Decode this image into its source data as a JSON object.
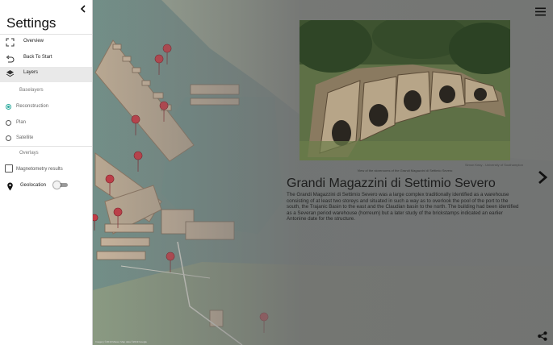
{
  "sidebar": {
    "title": "Settings",
    "items": [
      {
        "label": "Overview",
        "icon": "fullscreen-icon"
      },
      {
        "label": "Back To Start",
        "icon": "undo-icon"
      },
      {
        "label": "Layers",
        "icon": "layers-icon"
      }
    ],
    "baselayers_heading": "Baselayers",
    "baselayers": [
      {
        "label": "Reconstruction",
        "selected": true
      },
      {
        "label": "Plan",
        "selected": false
      },
      {
        "label": "Satellite",
        "selected": false
      }
    ],
    "overlays_heading": "Overlays",
    "overlays": [
      {
        "label": "Magnetometry results",
        "checked": false
      }
    ],
    "geolocation": {
      "label": "Geolocation",
      "icon": "location-pin-icon",
      "enabled": false
    },
    "accent_color": "#27a89b"
  },
  "panel": {
    "title": "Grandi Magazzini di Settimio Severo",
    "body": "The Grandi Magazzini di Settimio Severo was a large complex traditionally identified as a warehouse consisting of at least two storeys and situated in such a way as to overlook the pool of the port to the south, the Trajanic Basin to the east and the Claudian basin to the north. The building had been identified as a Severan period warehouse (horreum) but a later study of the brickstamps indicated an earlier Antonine date for the structure.",
    "photo_caption": "View of the storerooms of the Grandi Magazzini di Settimio Severo",
    "photo_credit": "Simon Keay - University of Southampton"
  },
  "map_attribution": "Imagery ©2019 Maxar, Map data ©2019 Google",
  "icons": {
    "menu": "hamburger-menu-icon",
    "next": "chevron-right-icon",
    "share": "share-icon",
    "back": "chevron-left-icon",
    "marker": "map-marker-icon"
  }
}
